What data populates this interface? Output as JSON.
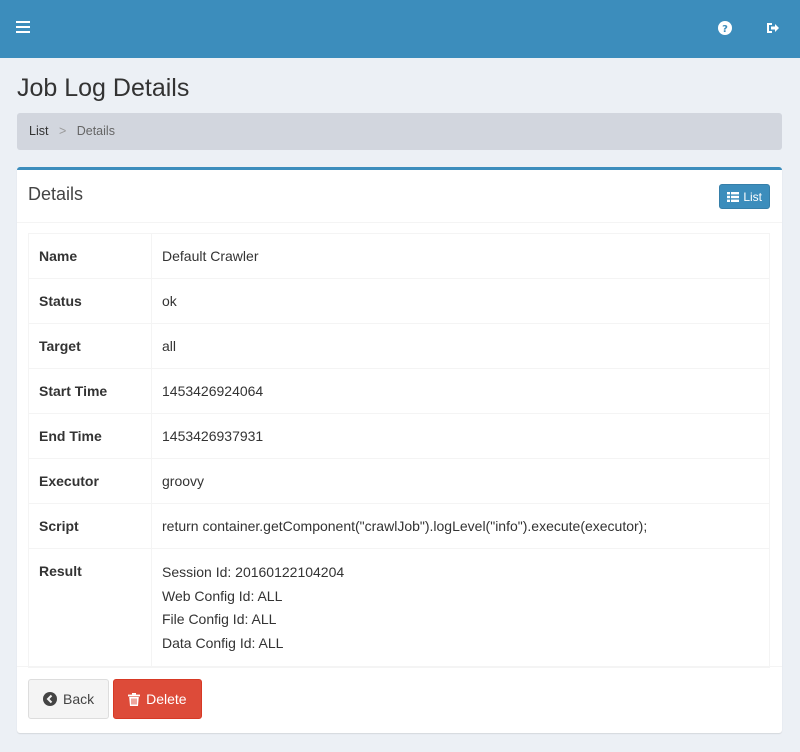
{
  "page": {
    "title": "Job Log Details"
  },
  "breadcrumb": {
    "list": "List",
    "separator": ">",
    "current": "Details"
  },
  "box": {
    "title": "Details",
    "list_button": "List"
  },
  "details": {
    "rows": [
      {
        "label": "Name",
        "value": "Default Crawler"
      },
      {
        "label": "Status",
        "value": "ok"
      },
      {
        "label": "Target",
        "value": "all"
      },
      {
        "label": "Start Time",
        "value": "1453426924064"
      },
      {
        "label": "End Time",
        "value": "1453426937931"
      },
      {
        "label": "Executor",
        "value": "groovy"
      },
      {
        "label": "Script",
        "value": "return container.getComponent(\"crawlJob\").logLevel(\"info\").execute(executor);"
      }
    ],
    "result": {
      "label": "Result",
      "lines": [
        "Session Id: 20160122104204",
        "Web Config Id: ALL",
        "File Config Id: ALL",
        "Data Config Id: ALL"
      ]
    }
  },
  "footer": {
    "back_label": "Back",
    "delete_label": "Delete"
  },
  "icons": {
    "menu": "menu-icon",
    "help": "question-circle-icon",
    "signout": "sign-out-icon",
    "list": "list-icon",
    "back": "arrow-circle-left-icon",
    "delete": "trash-icon"
  },
  "colors": {
    "primary": "#3c8dbc",
    "danger": "#dd4b39",
    "background": "#ecf0f5"
  }
}
